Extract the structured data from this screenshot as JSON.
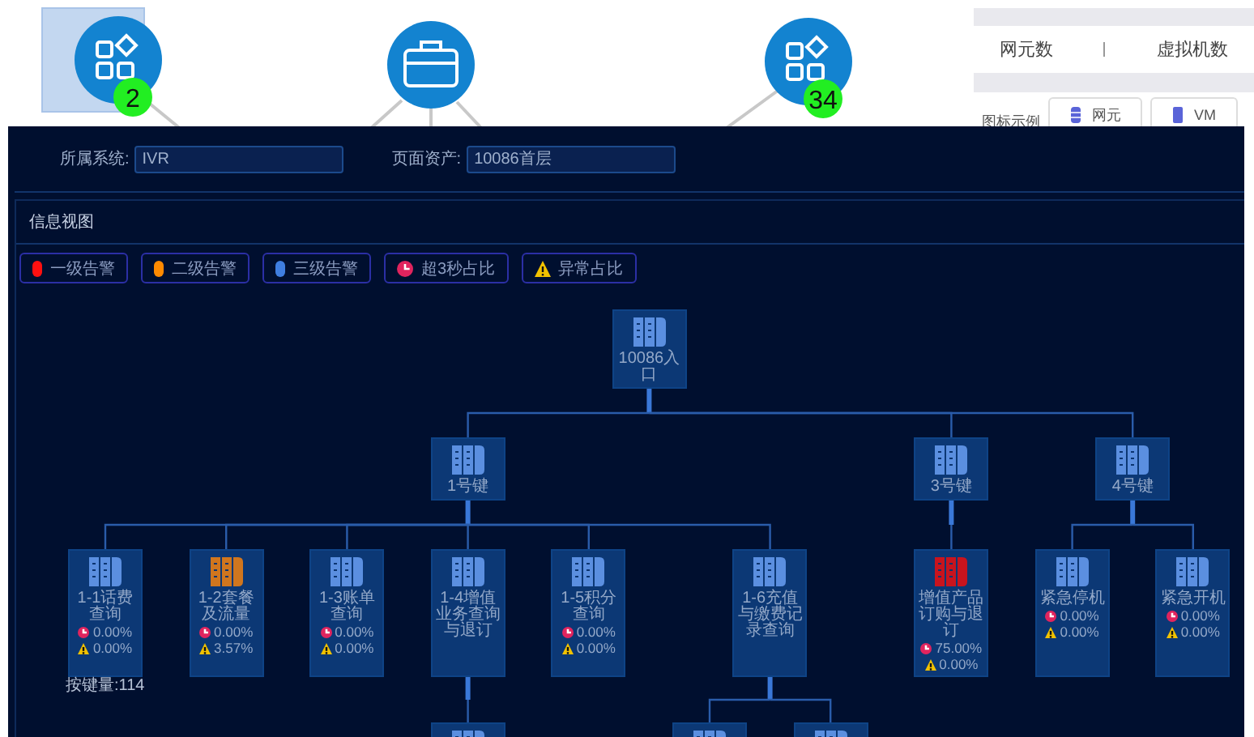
{
  "topology": {
    "nodes": [
      {
        "kind": "apps",
        "badge": "2",
        "selected": true
      },
      {
        "kind": "briefcase",
        "selected": false
      },
      {
        "kind": "apps",
        "badge": "34",
        "selected": false
      }
    ]
  },
  "summary": {
    "columns": [
      "网元数",
      "虚拟机数"
    ],
    "legend_label": "图标示例",
    "legend_items": [
      {
        "kind": "database",
        "label": "网元"
      },
      {
        "kind": "file",
        "label": "VM"
      }
    ]
  },
  "filters": [
    {
      "label": "所属系统:",
      "value": "IVR"
    },
    {
      "label": "页面资产:",
      "value": "10086首层"
    }
  ],
  "panel": {
    "title": "信息视图",
    "legend": [
      {
        "kind": "dot",
        "color": "#ff1010",
        "label": "一级告警"
      },
      {
        "kind": "dot",
        "color": "#ff8a00",
        "label": "二级告警"
      },
      {
        "kind": "dot",
        "color": "#3f7ee0",
        "label": "三级告警"
      },
      {
        "kind": "clock",
        "label": "超3秒占比"
      },
      {
        "kind": "warning",
        "label": "异常占比"
      }
    ],
    "tree": {
      "label": "10086入口",
      "color": "#5b8fe0",
      "children": [
        {
          "label": "1号键",
          "color": "#5b8fe0",
          "children": [
            {
              "label": "1-1话费查询",
              "color": "#5b8fe0",
              "timeout": "0.00%",
              "abnormal": "0.00%",
              "note": "按键量:114"
            },
            {
              "label": "1-2套餐及流量",
              "color": "#d0761e",
              "timeout": "0.00%",
              "abnormal": "3.57%"
            },
            {
              "label": "1-3账单查询",
              "color": "#5b8fe0",
              "timeout": "0.00%",
              "abnormal": "0.00%"
            },
            {
              "label": "1-4增值业务查询与退订",
              "color": "#5b8fe0",
              "children": [
                {
                  "color": "#5b8fe0"
                }
              ]
            },
            {
              "label": "1-5积分查询",
              "color": "#5b8fe0",
              "timeout": "0.00%",
              "abnormal": "0.00%"
            },
            {
              "label": "1-6充值与缴费记录查询",
              "color": "#5b8fe0",
              "children": [
                {
                  "color": "#5b8fe0"
                },
                {
                  "color": "#5b8fe0"
                }
              ]
            }
          ]
        },
        {
          "label": "3号键",
          "color": "#5b8fe0",
          "children": [
            {
              "label": "增值产品订购与退订",
              "color": "#c8141e",
              "timeout": "75.00%",
              "abnormal": "0.00%"
            }
          ]
        },
        {
          "label": "4号键",
          "color": "#5b8fe0",
          "children": [
            {
              "label": "紧急停机",
              "color": "#5b8fe0",
              "timeout": "0.00%",
              "abnormal": "0.00%"
            },
            {
              "label": "紧急开机",
              "color": "#5b8fe0",
              "timeout": "0.00%",
              "abnormal": "0.00%"
            }
          ]
        }
      ]
    }
  }
}
